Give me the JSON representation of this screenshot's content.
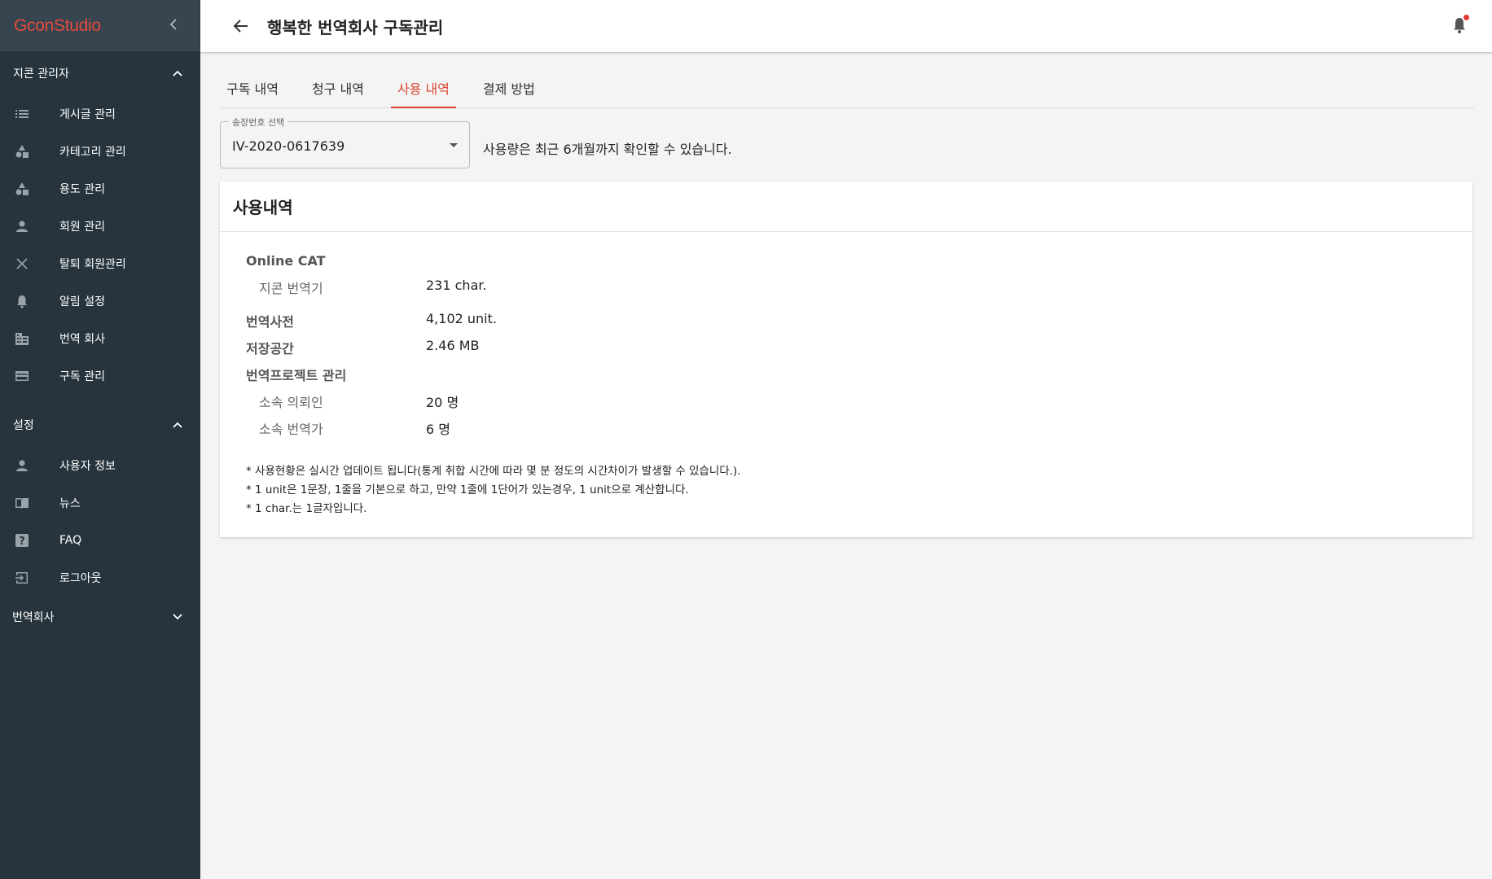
{
  "sidebar": {
    "logo": "GconStudio",
    "section1": "지콘 관리자",
    "items1": [
      {
        "label": "게시글 관리",
        "icon": "list-icon"
      },
      {
        "label": "카테고리 관리",
        "icon": "category-icon"
      },
      {
        "label": "용도 관리",
        "icon": "category-icon"
      },
      {
        "label": "회원 관리",
        "icon": "person-icon"
      },
      {
        "label": "탈퇴 회원관리",
        "icon": "close-icon"
      },
      {
        "label": "알림 설정",
        "icon": "bell-icon"
      },
      {
        "label": "번역 회사",
        "icon": "building-icon"
      },
      {
        "label": "구독 관리",
        "icon": "card-icon"
      }
    ],
    "section2": "설정",
    "items2": [
      {
        "label": "사용자 정보",
        "icon": "person-icon"
      },
      {
        "label": "뉴스",
        "icon": "book-icon"
      },
      {
        "label": "FAQ",
        "icon": "help-icon"
      },
      {
        "label": "로그아웃",
        "icon": "logout-icon"
      }
    ],
    "section3": "번역회사"
  },
  "header": {
    "title": "행복한 번역회사 구독관리"
  },
  "tabs": [
    {
      "label": "구독 내역",
      "active": false
    },
    {
      "label": "청구 내역",
      "active": false
    },
    {
      "label": "사용 내역",
      "active": true
    },
    {
      "label": "결제 방법",
      "active": false
    }
  ],
  "invoice_select": {
    "label": "송장번호 선택",
    "value": "IV-2020-0617639"
  },
  "hint": "사용량은 최근 6개월까지 확인할 수 있습니다.",
  "usage": {
    "title": "사용내역",
    "online_cat": "Online CAT",
    "translator_label": "지콘 번역기",
    "translator_value": "231 char.",
    "dictionary_label": "번역사전",
    "dictionary_value": "4,102 unit.",
    "storage_label": "저장공간",
    "storage_value": "2.46 MB",
    "project_label": "번역프로젝트 관리",
    "requesters_label": "소속 의뢰인",
    "requesters_value": "20 명",
    "translators_label": "소속 번역가",
    "translators_value": "6 명",
    "notes": [
      "* 사용현황은 실시간 업데이트 됩니다(통계 취합 시간에 따라 몇 분 정도의 시간차이가 발생할 수 있습니다.).",
      "* 1 unit은 1문장, 1줄을 기본으로 하고, 만약 1줄에 1단어가 있는경우, 1 unit으로 계산합니다.",
      "* 1 char.는 1글자입니다."
    ]
  },
  "colors": {
    "accent": "#d9442f",
    "sidebar_bg": "#27343e",
    "sidebar_top": "#364550"
  }
}
